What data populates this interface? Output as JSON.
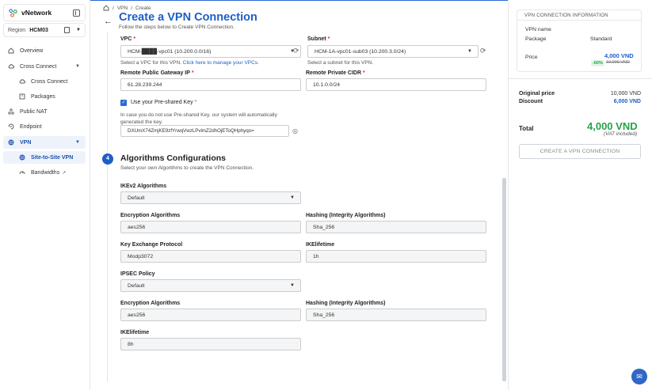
{
  "app": {
    "name": "vNetwork"
  },
  "region": {
    "label": "Region",
    "value": "HCM03"
  },
  "nav": {
    "overview": "Overview",
    "cross_connect": "Cross Connect",
    "cross_connect_sub": "Cross Connect",
    "packages": "Packages",
    "public_nat": "Public NAT",
    "endpoint": "Endpoint",
    "vpn": "VPN",
    "site_to_site": "Site-to-Site VPN",
    "bandwidths": "Bandwidths"
  },
  "breadcrumb": {
    "sep": "/",
    "vpn": "VPN",
    "create": "Create"
  },
  "header": {
    "title": "Create a VPN Connection",
    "subtitle": "Follow the steps below to Create VPN Connection."
  },
  "form": {
    "vpc": {
      "label": "VPC",
      "value": "HCM-████-vpc01 (10.200.0.0/16)",
      "hint": "Select a VPC for this VPN.",
      "link": "Click here to manage your VPCs."
    },
    "subnet": {
      "label": "Subnet",
      "value": "HCM-1A-vpc01-sub03 (10.200.3.0/24)",
      "hint": "Select a subnet for this VPN."
    },
    "remote_gateway": {
      "label": "Remote Public Gateway IP",
      "value": "61.28.239.244"
    },
    "remote_cidr": {
      "label": "Remote Private CIDR",
      "value": "10.1.0.0/24"
    },
    "psk": {
      "label": "Use your Pre-shared Key",
      "hint": "In case you do not use Pre-shared Key, our system will automatically generated the key.",
      "value": "DXUmX74ZmjKE9zfYrwqVwzLPvlmZ2dhOjEToQHphyqo="
    }
  },
  "algorithms": {
    "step": "4",
    "title": "Algorithms Configurations",
    "subtitle": "Select your own Algorithms to create the VPN Connection.",
    "ikev2": {
      "label": "IKEv2 Algorithms",
      "value": "Default"
    },
    "enc1": {
      "label": "Encryption Algorithms",
      "value": "aes256"
    },
    "hash1": {
      "label": "Hashing (Integrity Algorithms)",
      "value": "Sha_256"
    },
    "kex": {
      "label": "Key Exchange Protocol",
      "value": "Modp3072"
    },
    "ikelifetime1": {
      "label": "IKElifetime",
      "value": "1h"
    },
    "ipsec": {
      "label": "IPSEC Policy",
      "value": "Default"
    },
    "enc2": {
      "label": "Encryption Algorithms",
      "value": "aes256"
    },
    "hash2": {
      "label": "Hashing (Integrity Algorithms)",
      "value": "Sha_256"
    },
    "ikelifetime2": {
      "label": "IKElifetime",
      "value": "8h"
    }
  },
  "info": {
    "heading": "VPN CONNECTION INFORMATION",
    "name_label": "VPN name",
    "package_label": "Package",
    "package_value": "Standard",
    "price_label": "Price",
    "price_value": "4,000 VND",
    "discount_badge": "-60%",
    "price_original": "10,000 VND"
  },
  "summary": {
    "original_label": "Original price",
    "original_value": "10,000 VND",
    "discount_label": "Discount",
    "discount_value": "6,000 VND",
    "total_label": "Total",
    "total_value": "4,000 VND",
    "vat": "(VAT included)",
    "create_button": "CREATE A VPN CONNECTION"
  },
  "colors": {
    "primary": "#1e5ec8",
    "success": "#22a447"
  }
}
